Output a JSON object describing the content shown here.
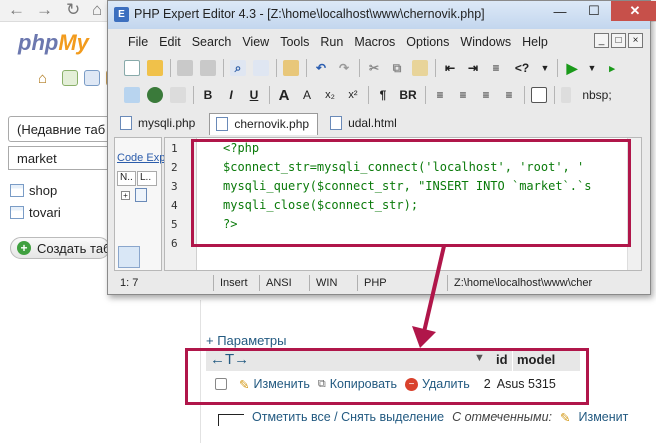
{
  "background": {
    "logo_php": "php",
    "logo_my": "My",
    "recent_tables": "(Недавние таб",
    "filter_value": "market",
    "tables": [
      "shop",
      "tovari"
    ],
    "create_table": "Создать таб",
    "params_link": "+ Параметры"
  },
  "editor": {
    "title": "PHP Expert Editor 4.3 - [Z:\\home\\localhost\\www\\chernovik.php]",
    "menu": [
      "File",
      "Edit",
      "Search",
      "View",
      "Tools",
      "Run",
      "Macros",
      "Options",
      "Windows",
      "Help"
    ],
    "tabs": [
      "mysqli.php",
      "chernovik.php",
      "udal.html"
    ],
    "explorer_title": "Code Exp",
    "explorer_cols": [
      "N..",
      "L.."
    ],
    "toolbar_text": {
      "bold": "B",
      "italic": "I",
      "underline": "U",
      "font_up": "A",
      "sub": "x₂",
      "sup": "x²",
      "para": "¶",
      "br": "BR",
      "nbsp": "nbsp;",
      "tag": "<?",
      "icon_a": "A"
    },
    "code_lines": [
      {
        "n": "1",
        "text": "<?php"
      },
      {
        "n": "2",
        "text": "$connect_str=mysqli_connect('localhost', 'root', '"
      },
      {
        "n": "3",
        "text": "mysqli_query($connect_str, \"INSERT INTO `market`.`s"
      },
      {
        "n": "4",
        "text": "mysqli_close($connect_str);"
      },
      {
        "n": "5",
        "text": "?>"
      },
      {
        "n": "6",
        "text": ""
      }
    ],
    "status": [
      "1: 7",
      "Insert",
      "ANSI",
      "WIN",
      "PHP",
      "Z:\\home\\localhost\\www\\cher"
    ]
  },
  "result": {
    "col_id": "id",
    "col_model": "model",
    "edit": "Изменить",
    "copy": "Копировать",
    "delete": "Удалить",
    "id": "2",
    "model": "Asus 5315",
    "check_all": "Отметить все / Снять выделение",
    "with_selected": "С отмеченными:",
    "footer_edit": "Изменит"
  },
  "colors": {
    "highlight": "#b0164a",
    "link": "#235a81",
    "title_bar": "#c3d6ee"
  }
}
